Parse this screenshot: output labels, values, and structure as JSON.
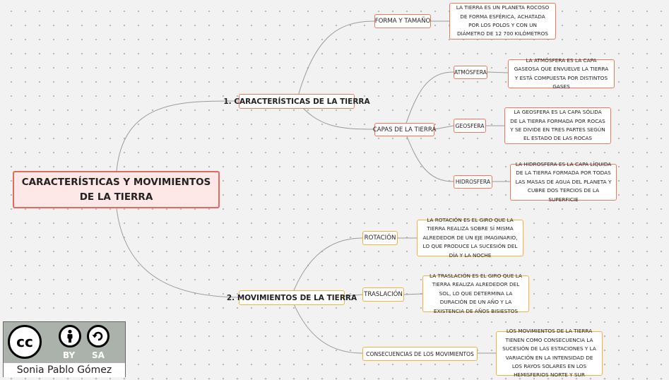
{
  "root": {
    "title": "CARACTERÍSTICAS Y MOVIMIENTOS DE LA TIERRA"
  },
  "caracteristicas": {
    "label": "1. CARACTERÍSTICAS DE LA TIERRA",
    "forma": {
      "label": "FORMA Y TAMAÑO",
      "desc": "LA TIERRA ES UN PLANETA ROCOSO DE FORMA ESFÉRICA, ACHATADA POR LOS POLOS Y CON UN DIÁMETRO DE 12 700 KILÓMETROS"
    },
    "capas": {
      "label": "CAPAS DE LA TIERRA",
      "atmosfera": {
        "label": "ATMÓSFERA",
        "desc": "LA ATMÓSFERA ES LA CAPA GASEOSA QUE ENVUELVE LA TIERRA Y ESTÁ COMPUESTA POR DISTINTOS GASES"
      },
      "geosfera": {
        "label": "GEOSFERA",
        "desc": "LA GEOSFERA ES LA CAPA SÓLIDA DE LA TIERRA FORMADA POR ROCAS Y SE DIVIDE EN TRES PARTES SEGÚN EL ESTADO DE LAS ROCAS"
      },
      "hidrosfera": {
        "label": "HIDROSFERA",
        "desc": "LA HIDROSFERA ES LA CAPA LÍQUIDA DE LA TIERRA FORMADA POR TODAS LAS MASAS DE AGUA DEL PLANETA Y CUBRE DOS TERCIOS DE LA SUPERFICIE"
      }
    }
  },
  "movimientos": {
    "label": "2. MOVIMIENTOS DE LA TIERRA",
    "rotacion": {
      "label": "ROTACIÓN",
      "desc": "LA ROTACIÓN ES EL GIRO QUE LA TIERRA REALIZA SOBRE SÍ MISMA ALREDEDOR DE UN EJE IMAGINARIO, LO QUE PRODUCE LA SUCESIÓN DEL DÍA Y LA NOCHE"
    },
    "traslacion": {
      "label": "TRASLACIÓN",
      "desc": "LA TRASLACIÓN ES EL GIRO QUE LA TIERRA REALIZA ALREDEDOR DEL SOL, LO QUE DETERMINA LA DURACIÓN DE UN AÑO Y LA EXISTENCIA DE AÑOS BISIESTOS"
    },
    "consecuencias": {
      "label": "CONSECUENCIAS DE LOS MOVIMIENTOS",
      "desc": "LOS MOVIMIENTOS DE LA TIERRA TIENEN COMO CONSECUENCIA LA SUCESIÓN DE LAS ESTACIONES Y LA VARIACIÓN EN LA INTENSIDAD DE LOS RAYOS SOLARES EN LOS HEMISFERIOS NORTE Y SUR"
    }
  },
  "license": {
    "logo_text": "cc",
    "by_label": "BY",
    "sa_label": "SA",
    "author": "Sonia Pablo Gómez"
  },
  "colors": {
    "root_border": "#e26a5c",
    "root_fill": "#fde7e7",
    "characteristics_border": "#ef7a5b",
    "movements_border": "#f3b23f",
    "connector": "#9a9a9a"
  }
}
